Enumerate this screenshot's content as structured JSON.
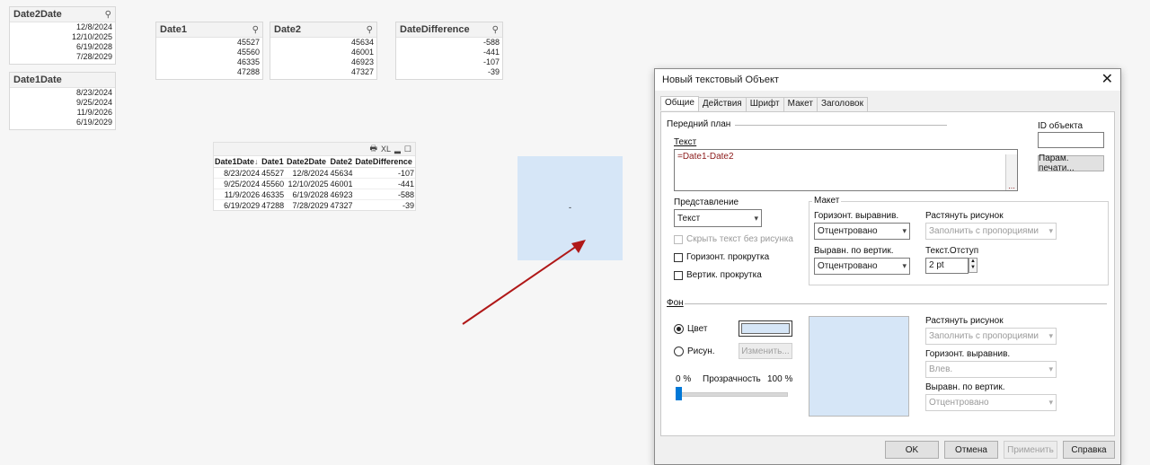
{
  "listboxes": {
    "date2date": {
      "title": "Date2Date",
      "values": [
        "12/8/2024",
        "12/10/2025",
        "6/19/2028",
        "7/28/2029"
      ]
    },
    "date1date": {
      "title": "Date1Date",
      "values": [
        "8/23/2024",
        "9/25/2024",
        "11/9/2026",
        "6/19/2029"
      ]
    },
    "date1": {
      "title": "Date1",
      "values": [
        "45527",
        "45560",
        "46335",
        "47288"
      ]
    },
    "date2": {
      "title": "Date2",
      "values": [
        "45634",
        "46001",
        "46923",
        "47327"
      ]
    },
    "datedifference": {
      "title": "DateDifference",
      "values": [
        "-588",
        "-441",
        "-107",
        "-39"
      ]
    }
  },
  "search_icon": "magnifier-icon",
  "table": {
    "tools": {
      "print": "🖶",
      "xl": "XL",
      "minimize": "▂",
      "maximize": "☐"
    },
    "columns": [
      "Date1Date",
      "Date1",
      "Date2Date",
      "Date2",
      "DateDifference"
    ],
    "sort_marker": "↓",
    "rows": [
      [
        "8/23/2024",
        "45527",
        "12/8/2024",
        "45634",
        "-107"
      ],
      [
        "9/25/2024",
        "45560",
        "12/10/2025",
        "46001",
        "-441"
      ],
      [
        "11/9/2026",
        "46335",
        "6/19/2028",
        "46923",
        "-588"
      ],
      [
        "6/19/2029",
        "47288",
        "7/28/2029",
        "47327",
        "-39"
      ]
    ]
  },
  "text_object": {
    "content": "-",
    "color": "#d6e6f7"
  },
  "arrow_color": "#b01818",
  "dialog": {
    "title": "Новый текстовый Объект",
    "close": "✕",
    "tabs": [
      "Общие",
      "Действия",
      "Шрифт",
      "Макет",
      "Заголовок"
    ],
    "foreground_label": "Передний план",
    "text_label": "Текст",
    "text_value": "=Date1-Date2",
    "ellipsis": "...",
    "object_id_label": "ID объекта",
    "object_id_value": "",
    "print_params_label": "Парам. печати...",
    "representation_label": "Представление",
    "representation_value": "Текст",
    "hide_text_label": "Скрыть текст без рисунка",
    "h_scroll_label": "Горизонт. прокрутка",
    "v_scroll_label": "Вертик. прокрутка",
    "layout_label": "Макет",
    "h_align_label": "Горизонт. выравнив.",
    "h_align_value": "Отцентровано",
    "stretch_label": "Растянуть рисунок",
    "stretch_value": "Заполнить с пропорциями",
    "v_align_label": "Выравн. по вертик.",
    "v_align_value": "Отцентровано",
    "text_indent_label": "Текст.Отступ",
    "text_indent_value": "2 pt",
    "background_label": "Фон",
    "color_radio_label": "Цвет",
    "image_radio_label": "Рисун.",
    "change_button": "Изменить...",
    "transparency_min": "0 %",
    "transparency_label": "Прозрачность",
    "transparency_max": "100 %",
    "transparency_value": 0,
    "bg_stretch_label": "Растянуть рисунок",
    "bg_stretch_value": "Заполнить с пропорциями",
    "bg_h_align_label": "Горизонт. выравнив.",
    "bg_h_align_value": "Влев.",
    "bg_v_align_label": "Выравн. по вертик.",
    "bg_v_align_value": "Отцентровано",
    "buttons": {
      "ok": "OK",
      "cancel": "Отмена",
      "apply": "Применить",
      "help": "Справка"
    }
  }
}
